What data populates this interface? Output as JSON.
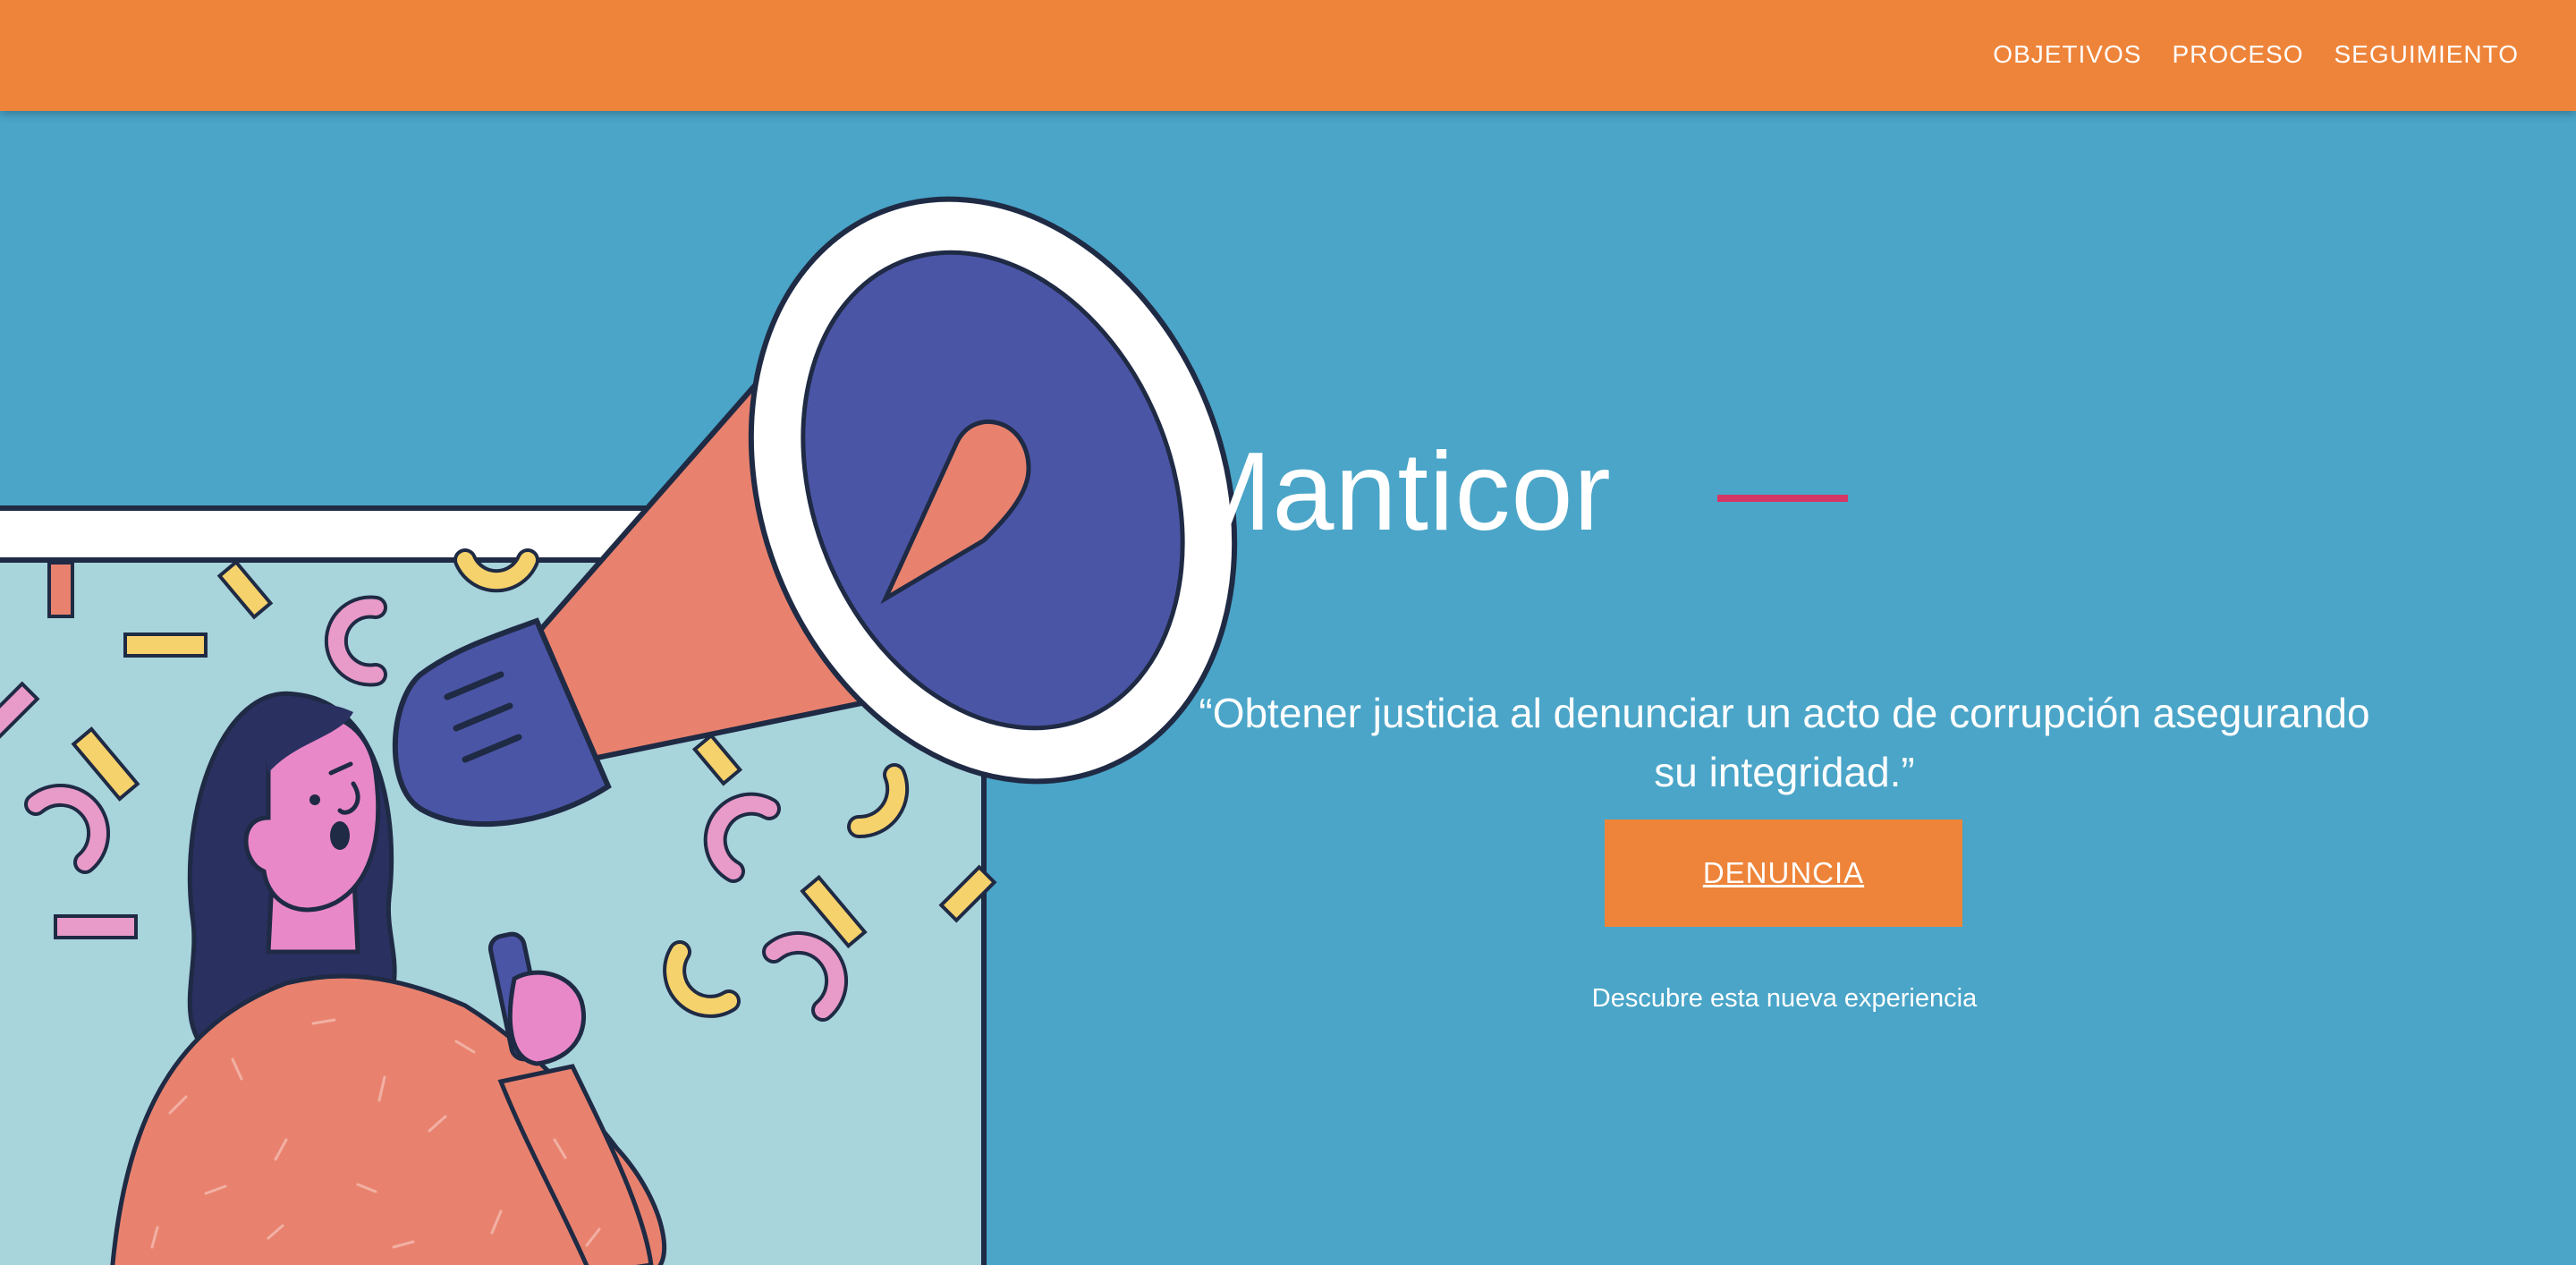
{
  "nav": {
    "items": [
      "OBJETIVOS",
      "PROCESO",
      "SEGUIMIENTO"
    ]
  },
  "hero": {
    "title": "Manticor",
    "quote": "“Obtener justicia al denunciar un acto de corrupción asegurando su integridad.”",
    "cta_label": "DENUNCIA",
    "subtitle": "Descubre esta nueva experiencia"
  },
  "illustration": {
    "icon": "woman-megaphone-illustration"
  },
  "colors": {
    "nav_background": "#ee843a",
    "page_background": "#4aa5c8",
    "accent_line": "#d63664",
    "button": "#ee843a",
    "text": "#ffffff"
  }
}
